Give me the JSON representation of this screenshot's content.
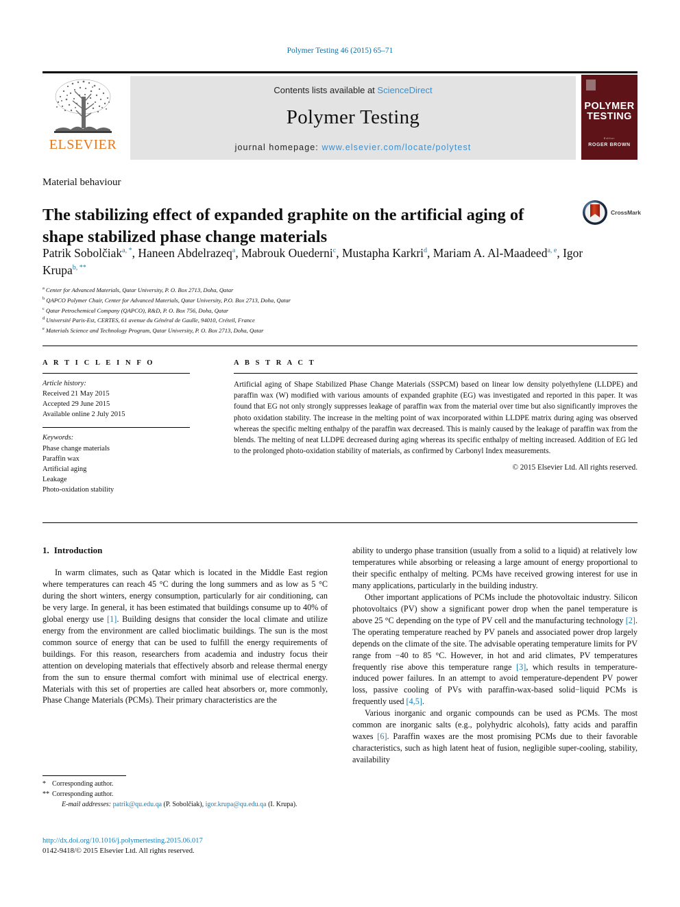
{
  "running_head": "Polymer Testing 46 (2015) 65–71",
  "masthead": {
    "publisher_name": "ELSEVIER",
    "contents_prefix": "Contents lists available at ",
    "contents_link": "ScienceDirect",
    "journal_name": "Polymer Testing",
    "homepage_prefix": "journal homepage: ",
    "homepage_url": "www.elsevier.com/locate/polytest",
    "cover": {
      "title_line1": "POLYMER",
      "title_line2": "TESTING",
      "editor_label": "Editor",
      "editor_name": "ROGER BROWN"
    }
  },
  "section_label": "Material behaviour",
  "title": "The stabilizing effect of expanded graphite on the artificial aging of shape stabilized phase change materials",
  "crossmark_label": "CrossMark",
  "authors": [
    {
      "name": "Patrik Sobolčiak",
      "markers": "a, *"
    },
    {
      "name": "Haneen Abdelrazeq",
      "markers": "a"
    },
    {
      "name": "Mabrouk Ouederni",
      "markers": "c"
    },
    {
      "name": "Mustapha Karkri",
      "markers": "d"
    },
    {
      "name": "Mariam A. Al-Maadeed",
      "markers": "a, e"
    },
    {
      "name": "Igor Krupa",
      "markers": "b, **"
    }
  ],
  "affiliations": [
    {
      "marker": "a",
      "text": "Center for Advanced Materials, Qatar University, P. O. Box 2713, Doha, Qatar"
    },
    {
      "marker": "b",
      "text": "QAPCO Polymer Chair, Center for Advanced Materials, Qatar University, P.O. Box 2713, Doha, Qatar"
    },
    {
      "marker": "c",
      "text": "Qatar Petrochemical Company (QAPCO), R&D, P. O. Box 756, Doha, Qatar"
    },
    {
      "marker": "d",
      "text": "Université Paris-Est, CERTES, 61 avenue du Général de Gaulle, 94010, Créteil, France"
    },
    {
      "marker": "e",
      "text": "Materials Science and Technology Program, Qatar University, P. O. Box 2713, Doha, Qatar"
    }
  ],
  "article_info": {
    "heading": "A R T I C L E   I N F O",
    "history_label": "Article history:",
    "history": [
      "Received 21 May 2015",
      "Accepted 29 June 2015",
      "Available online 2 July 2015"
    ],
    "keywords_label": "Keywords:",
    "keywords": [
      "Phase change materials",
      "Paraffin wax",
      "Artificial aging",
      "Leakage",
      "Photo-oxidation stability"
    ]
  },
  "abstract": {
    "heading": "A B S T R A C T",
    "text": "Artificial aging of Shape Stabilized Phase Change Materials (SSPCM) based on linear low density polyethylene (LLDPE) and paraffin wax (W) modified with various amounts of expanded graphite (EG) was investigated and reported in this paper. It was found that EG not only strongly suppresses leakage of paraffin wax from the material over time but also significantly improves the photo oxidation stability. The increase in the melting point of wax incorporated within LLDPE matrix during aging was observed whereas the specific melting enthalpy of the paraffin wax decreased. This is mainly caused by the leakage of paraffin wax from the blends. The melting of neat LLDPE decreased during aging whereas its specific enthalpy of melting increased. Addition of EG led to the prolonged photo-oxidation stability of materials, as confirmed by Carbonyl Index measurements.",
    "copyright": "© 2015 Elsevier Ltd. All rights reserved."
  },
  "body": {
    "section_number": "1.",
    "section_title": "Introduction",
    "left_paragraphs": [
      "In warm climates, such as Qatar which is located in the Middle East region where temperatures can reach 45 °C during the long summers and as low as 5 °C during the short winters, energy consumption, particularly for air conditioning, can be very large. In general, it has been estimated that buildings consume up to 40% of global energy use [1]. Building designs that consider the local climate and utilize energy from the environment are called bioclimatic buildings. The sun is the most common source of energy that can be used to fulfill the energy requirements of buildings. For this reason, researchers from academia and industry focus their attention on developing materials that effectively absorb and release thermal energy from the sun to ensure thermal comfort with minimal use of electrical energy. Materials with this set of properties are called heat absorbers or, more commonly, Phase Change Materials (PCMs). Their primary characteristics are the"
    ],
    "right_paragraphs": [
      "ability to undergo phase transition (usually from a solid to a liquid) at relatively low temperatures while absorbing or releasing a large amount of energy proportional to their specific enthalpy of melting. PCMs have received growing interest for use in many applications, particularly in the building industry.",
      "Other important applications of PCMs include the photovoltaic industry. Silicon photovoltaics (PV) show a significant power drop when the panel temperature is above 25 °C depending on the type of PV cell and the manufacturing technology [2]. The operating temperature reached by PV panels and associated power drop largely depends on the climate of the site. The advisable operating temperature limits for PV range from −40 to 85 °C. However, in hot and arid climates, PV temperatures frequently rise above this temperature range [3], which results in temperature-induced power failures. In an attempt to avoid temperature-dependent PV power loss, passive cooling of PVs with paraffin-wax-based solid−liquid PCMs is frequently used [4,5].",
      "Various inorganic and organic compounds can be used as PCMs. The most common are inorganic salts (e.g., polyhydric alcohols), fatty acids and paraffin waxes [6]. Paraffin waxes are the most promising PCMs due to their favorable characteristics, such as high latent heat of fusion, negligible super-cooling, stability, availability"
    ]
  },
  "footnotes": {
    "corresponding_1_marker": "*",
    "corresponding_1": "Corresponding author.",
    "corresponding_2_marker": "**",
    "corresponding_2": "Corresponding author.",
    "email_label": "E-mail addresses:",
    "email_1": "patrik@qu.edu.qa",
    "email_1_owner": "(P. Sobolčiak),",
    "email_2": "igor.krupa@qu.edu.qa",
    "email_2_owner": "(I. Krupa)."
  },
  "doi": "http://dx.doi.org/10.1016/j.polymertesting.2015.06.017",
  "issn_line": "0142-9418/© 2015 Elsevier Ltd. All rights reserved.",
  "colors": {
    "link": "#1a7fb5",
    "sd_link": "#3a8fd0",
    "elsevier_orange": "#e8761b",
    "cover_maroon": "#5e1318",
    "band_gray": "#e3e3e3"
  }
}
